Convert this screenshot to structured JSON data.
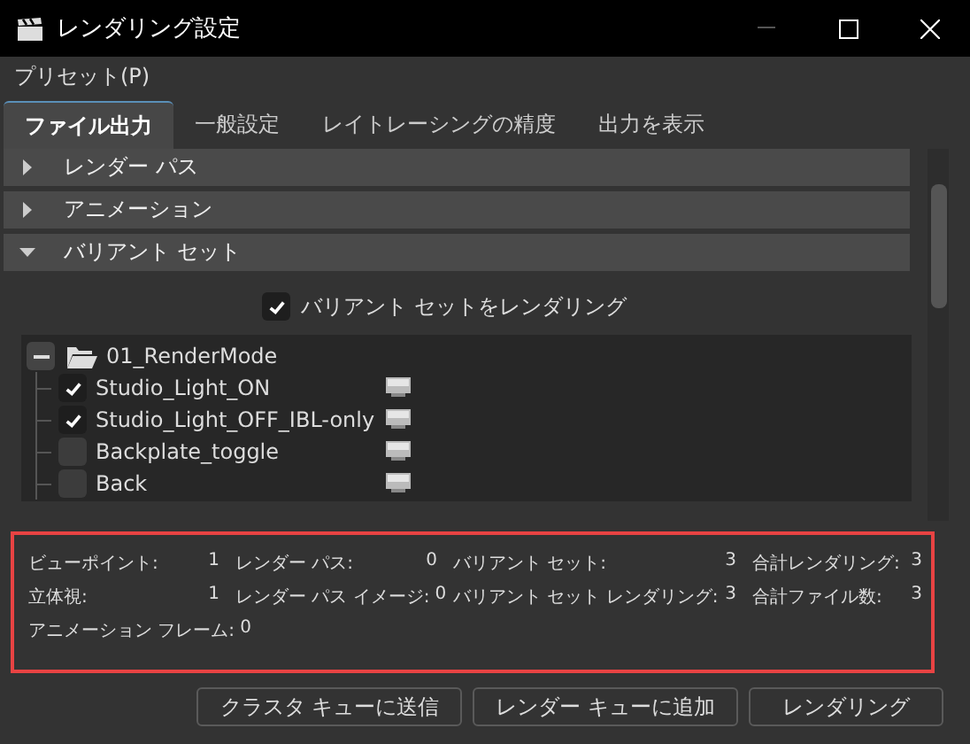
{
  "window": {
    "title": "レンダリング設定"
  },
  "menu": [
    {
      "label": "プリセット(P)"
    }
  ],
  "tabs": [
    {
      "label": "ファイル出力",
      "selected": true
    },
    {
      "label": "一般設定",
      "selected": false
    },
    {
      "label": "レイトレーシングの精度",
      "selected": false
    },
    {
      "label": "出力を表示",
      "selected": false
    }
  ],
  "sections": [
    {
      "label": "レンダー パス",
      "expanded": false
    },
    {
      "label": "アニメーション",
      "expanded": false
    },
    {
      "label": "バリアント セット",
      "expanded": true
    }
  ],
  "render_variants": {
    "label": "バリアント セットをレンダリング",
    "checked": true
  },
  "tree": [
    {
      "kind": "folder",
      "label": "01_RenderMode",
      "expanded": true,
      "children": [
        {
          "kind": "item",
          "label": "Studio_Light_ON",
          "checked": true
        },
        {
          "kind": "item",
          "label": "Studio_Light_OFF_IBL-only",
          "checked": true
        },
        {
          "kind": "item",
          "label": "Backplate_toggle",
          "checked": false
        },
        {
          "kind": "item",
          "label": "Back",
          "checked": false
        }
      ]
    }
  ],
  "summary": [
    [
      {
        "label": "ビューポイント:",
        "value": "1"
      },
      {
        "label": "レンダー パス:",
        "value": "0"
      },
      {
        "label": "バリアント セット:",
        "value": "3"
      },
      {
        "label": "合計レンダリング:",
        "value": "3"
      }
    ],
    [
      {
        "label": "立体視:",
        "value": "1"
      },
      {
        "label": "レンダー パス イメージ:",
        "value": "0"
      },
      {
        "label": "バリアント セット レンダリング:",
        "value": "3"
      },
      {
        "label": "合計ファイル数:",
        "value": "3"
      }
    ],
    [
      {
        "label": "アニメーション フレーム:",
        "value": "0"
      }
    ]
  ],
  "buttons": [
    {
      "label": "クラスタ キューに送信"
    },
    {
      "label": "レンダー キューに追加"
    },
    {
      "label": "レンダリング"
    }
  ]
}
